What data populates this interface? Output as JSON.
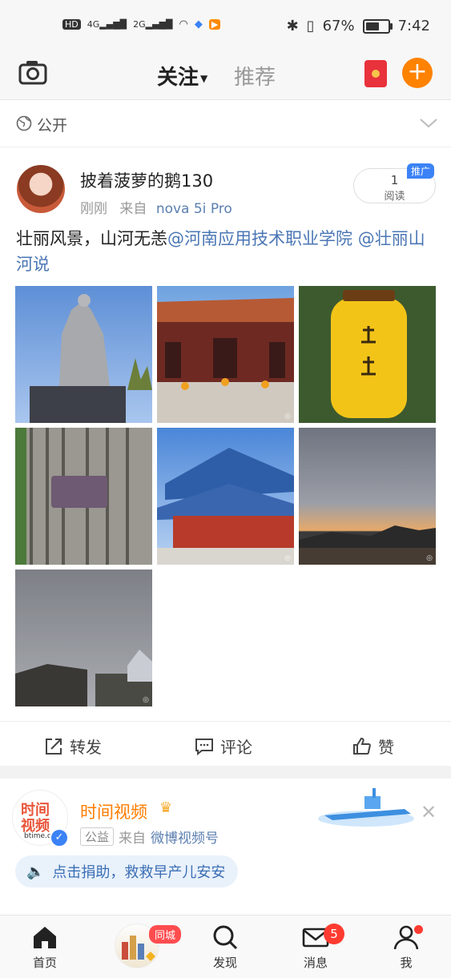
{
  "status_bar": {
    "left_indicators": [
      "HD",
      "4G",
      "2G"
    ],
    "battery_percent": "67%",
    "battery_level": 0.67,
    "time": "7:42"
  },
  "top_nav": {
    "tab_follow": "关注",
    "tab_recommend": "推荐"
  },
  "visibility": {
    "label": "公开"
  },
  "post": {
    "username": "披着菠萝的鹅130",
    "time": "刚刚",
    "source_prefix": "来自",
    "device": "nova 5i Pro",
    "read_count": "1",
    "read_label": "阅读",
    "promo_tag": "推广",
    "text_plain": "壮丽风景，山河无恙",
    "mention_1": "@河南应用技术职业学院",
    "mention_2": "@壮丽山河说",
    "photo_count": 7,
    "actions": {
      "repost": "转发",
      "comment": "评论",
      "like": "赞"
    }
  },
  "post2": {
    "avatar_line1": "时间",
    "avatar_line2": "视频",
    "avatar_domain": "btime.c",
    "name": "时间视频",
    "tag": "公益",
    "source_prefix": "来自",
    "source": "微博视频号",
    "donate_text": "点击捐助，救救早产儿安安"
  },
  "tab_bar": {
    "home": "首页",
    "city_badge": "同城",
    "discover": "发现",
    "messages": "消息",
    "messages_badge": "5",
    "me": "我"
  },
  "colors": {
    "accent_orange": "#ff8200",
    "link_blue": "#4a76b4",
    "badge_red": "#ff3b30"
  }
}
